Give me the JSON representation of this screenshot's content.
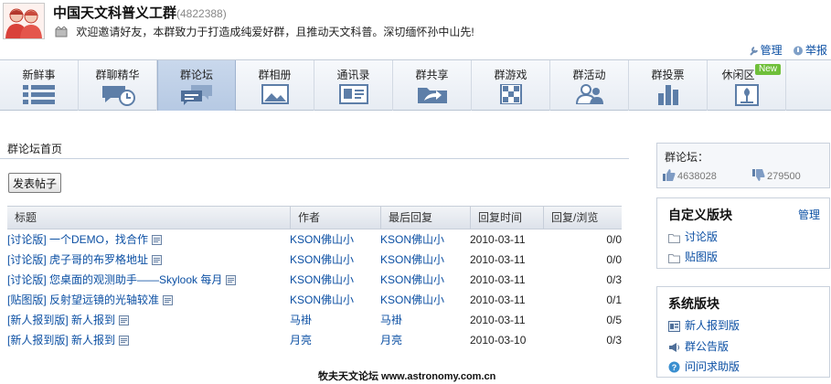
{
  "header": {
    "title": "中国天文科普义工群",
    "group_id": "(4822388)",
    "announcement": "欢迎邀请好友，本群致力于打造成纯爱好群，且推动天文科普。深切缅怀孙中山先!",
    "manage_label": "管理",
    "report_label": "举报"
  },
  "tabs": [
    {
      "label": "新鲜事",
      "icon": "news-feed-icon"
    },
    {
      "label": "群聊精华",
      "icon": "chat-highlight-icon"
    },
    {
      "label": "群论坛",
      "icon": "forum-icon",
      "active": true
    },
    {
      "label": "群相册",
      "icon": "photo-album-icon"
    },
    {
      "label": "通讯录",
      "icon": "contacts-icon"
    },
    {
      "label": "群共享",
      "icon": "share-folder-icon"
    },
    {
      "label": "群游戏",
      "icon": "game-icon"
    },
    {
      "label": "群活动",
      "icon": "activity-icon"
    },
    {
      "label": "群投票",
      "icon": "vote-icon"
    },
    {
      "label": "休闲区",
      "icon": "leisure-icon",
      "badge": "New"
    }
  ],
  "forum": {
    "breadcrumb": "群论坛首页",
    "post_button": "发表帖子",
    "columns": [
      "标题",
      "作者",
      "最后回复",
      "回复时间",
      "回复/浏览"
    ],
    "rows": [
      {
        "title": "[讨论版] 一个DEMO，找合作",
        "author": "KSON佛山小",
        "last_reply": "KSON佛山小",
        "time": "2010-03-11",
        "count": "0/0"
      },
      {
        "title": "[讨论版] 虎子哥的布罗格地址",
        "author": "KSON佛山小",
        "last_reply": "KSON佛山小",
        "time": "2010-03-11",
        "count": "0/0"
      },
      {
        "title": "[讨论版] 您桌面的观测助手——Skylook 每月",
        "author": "KSON佛山小",
        "last_reply": "KSON佛山小",
        "time": "2010-03-11",
        "count": "0/3"
      },
      {
        "title": "[贴图版] 反射望远镜的光轴较准",
        "author": "KSON佛山小",
        "last_reply": "KSON佛山小",
        "time": "2010-03-11",
        "count": "0/1"
      },
      {
        "title": "[新人报到版] 新人报到",
        "author": "马褂",
        "last_reply": "马褂",
        "time": "2010-03-11",
        "count": "0/5"
      },
      {
        "title": "[新人报到版] 新人报到",
        "author": "月亮",
        "last_reply": "月亮",
        "time": "2010-03-10",
        "count": "0/3"
      }
    ]
  },
  "sidebar": {
    "forum_label": "群论坛：",
    "likes": "4638028",
    "dislikes": "279500",
    "custom": {
      "title": "自定义版块",
      "manage": "管理",
      "items": [
        "讨论版",
        "贴图版"
      ]
    },
    "system": {
      "title": "系统版块",
      "items": [
        "新人报到版",
        "群公告版",
        "问问求助版"
      ]
    }
  },
  "watermark": "牧夫天文论坛 www.astronomy.com.cn",
  "colors": {
    "link": "#0b4fa3",
    "tab_active": "#b6c9e3",
    "new_badge": "#6fbf3a"
  }
}
